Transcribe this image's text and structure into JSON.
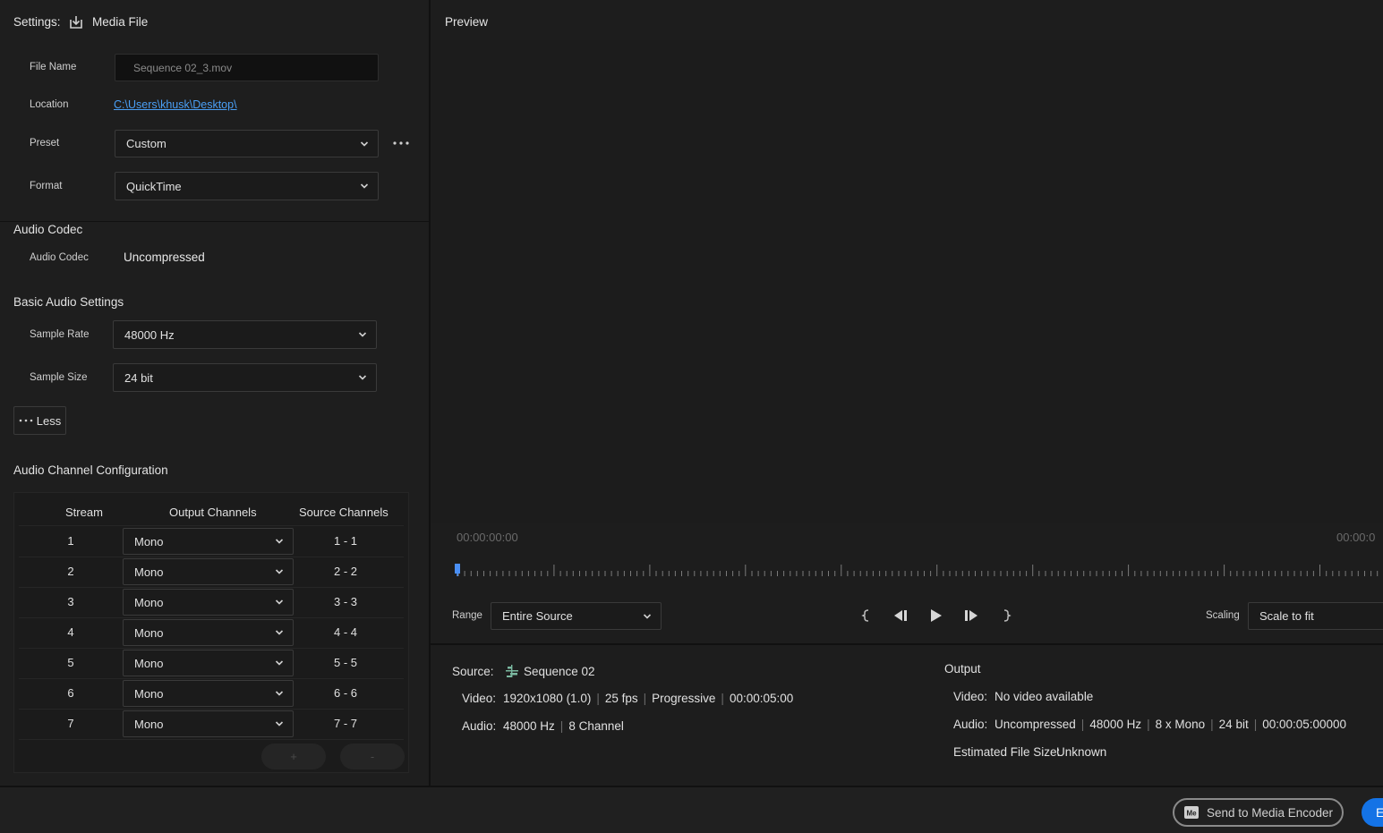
{
  "settings": {
    "label": "Settings:",
    "tab": "Media File",
    "file_name_label": "File Name",
    "file_name_value": "Sequence 02_3.mov",
    "location_label": "Location",
    "location_value": "C:\\Users\\khusk\\Desktop\\",
    "preset_label": "Preset",
    "preset_value": "Custom",
    "format_label": "Format",
    "format_value": "QuickTime"
  },
  "audio_codec": {
    "title": "Audio Codec",
    "label": "Audio Codec",
    "value": "Uncompressed"
  },
  "basic_audio": {
    "title": "Basic Audio Settings",
    "sample_rate_label": "Sample Rate",
    "sample_rate_value": "48000 Hz",
    "sample_size_label": "Sample Size",
    "sample_size_value": "24 bit",
    "less_label": "Less"
  },
  "channel_config": {
    "title": "Audio Channel Configuration",
    "headers": [
      "Stream",
      "Output Channels",
      "Source Channels"
    ],
    "rows": [
      {
        "stream": "1",
        "output": "Mono",
        "source": "1 - 1"
      },
      {
        "stream": "2",
        "output": "Mono",
        "source": "2 - 2"
      },
      {
        "stream": "3",
        "output": "Mono",
        "source": "3 - 3"
      },
      {
        "stream": "4",
        "output": "Mono",
        "source": "4 - 4"
      },
      {
        "stream": "5",
        "output": "Mono",
        "source": "5 - 5"
      },
      {
        "stream": "6",
        "output": "Mono",
        "source": "6 - 6"
      },
      {
        "stream": "7",
        "output": "Mono",
        "source": "7 - 7"
      }
    ],
    "add_label": "+",
    "remove_label": "-"
  },
  "preview": {
    "title": "Preview",
    "timecode_start": "00:00:00:00",
    "timecode_end": "00:00:0",
    "range_label": "Range",
    "range_value": "Entire Source",
    "scaling_label": "Scaling",
    "scaling_value": "Scale to fit"
  },
  "source_info": {
    "title": "Source:",
    "name": "Sequence 02",
    "video_key": "Video:",
    "video_parts": [
      "1920x1080 (1.0)",
      "25 fps",
      "Progressive",
      "00:00:05:00"
    ],
    "audio_key": "Audio:",
    "audio_parts": [
      "48000 Hz",
      "8 Channel"
    ]
  },
  "output_info": {
    "title": "Output",
    "video_key": "Video:",
    "video_value": "No video available",
    "audio_key": "Audio:",
    "audio_parts": [
      "Uncompressed",
      "48000 Hz",
      "8 x Mono",
      "24 bit",
      "00:00:05:00000"
    ],
    "size_key": "Estimated File Size:",
    "size_value": "Unknown"
  },
  "footer": {
    "send_label": "Send to Media Encoder",
    "export_label": "E"
  },
  "colors": {
    "accent": "#1473e6",
    "link": "#4a9ff5",
    "playhead": "#4a8ff5"
  }
}
